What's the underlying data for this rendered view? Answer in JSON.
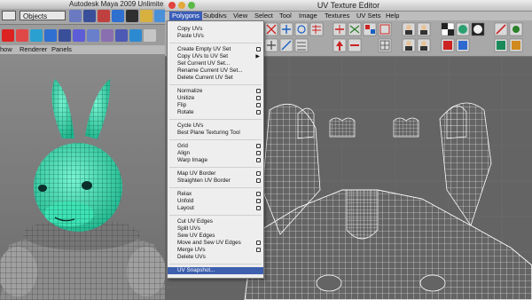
{
  "maya": {
    "title": "Autodesk Maya 2009 Unlimite",
    "selector_value": "Objects",
    "panel_menu": [
      "how",
      "Renderer",
      "Panels"
    ]
  },
  "uv_editor": {
    "title": "UV Texture Editor",
    "menus": [
      "Polygons",
      "Subdivs",
      "View",
      "Select",
      "Tool",
      "Image",
      "Textures",
      "UV Sets",
      "Help"
    ],
    "active_menu": "Polygons"
  },
  "polygons_menu": {
    "items": [
      {
        "label": "Copy UVs",
        "option": false
      },
      {
        "label": "Paste UVs",
        "option": false
      },
      {
        "label": "Create Empty UV Set",
        "option": true
      },
      {
        "label": "Copy UVs to UV Set",
        "submenu": true
      },
      {
        "label": "Set Current UV Set...",
        "option": false
      },
      {
        "label": "Rename Current UV Set...",
        "option": false
      },
      {
        "label": "Delete Current UV Set",
        "option": false
      },
      {
        "label": "Normalize",
        "option": true
      },
      {
        "label": "Unitize",
        "option": true
      },
      {
        "label": "Flip",
        "option": true
      },
      {
        "label": "Rotate",
        "option": true
      },
      {
        "label": "Cycle UVs",
        "option": false
      },
      {
        "label": "Best Plane Texturing Tool",
        "option": false
      },
      {
        "label": "Grid",
        "option": true
      },
      {
        "label": "Align",
        "option": true
      },
      {
        "label": "Warp Image",
        "option": true
      },
      {
        "label": "Map UV Border",
        "option": true
      },
      {
        "label": "Straighten UV Border",
        "option": true
      },
      {
        "label": "Relax",
        "option": true
      },
      {
        "label": "Unfold",
        "option": true
      },
      {
        "label": "Layout",
        "option": true
      },
      {
        "label": "Cut UV Edges",
        "option": false
      },
      {
        "label": "Split UVs",
        "option": false
      },
      {
        "label": "Sew UV Edges",
        "option": false
      },
      {
        "label": "Move and Sew UV Edges",
        "option": true
      },
      {
        "label": "Merge UVs",
        "option": true
      },
      {
        "label": "Delete UVs",
        "option": false
      },
      {
        "label": "UV Snapshot...",
        "option": false,
        "highlighted": true
      }
    ]
  },
  "colors": {
    "menu_highlight": "#3d5fae",
    "mesh_selected": "#2fe0b0",
    "uv_wire": "#ffffff",
    "canvas_bg": "#646464"
  },
  "icons": [
    "gear-icon",
    "uv-tool-icon",
    "checker-icon",
    "wireframe-icon",
    "render-icon"
  ]
}
